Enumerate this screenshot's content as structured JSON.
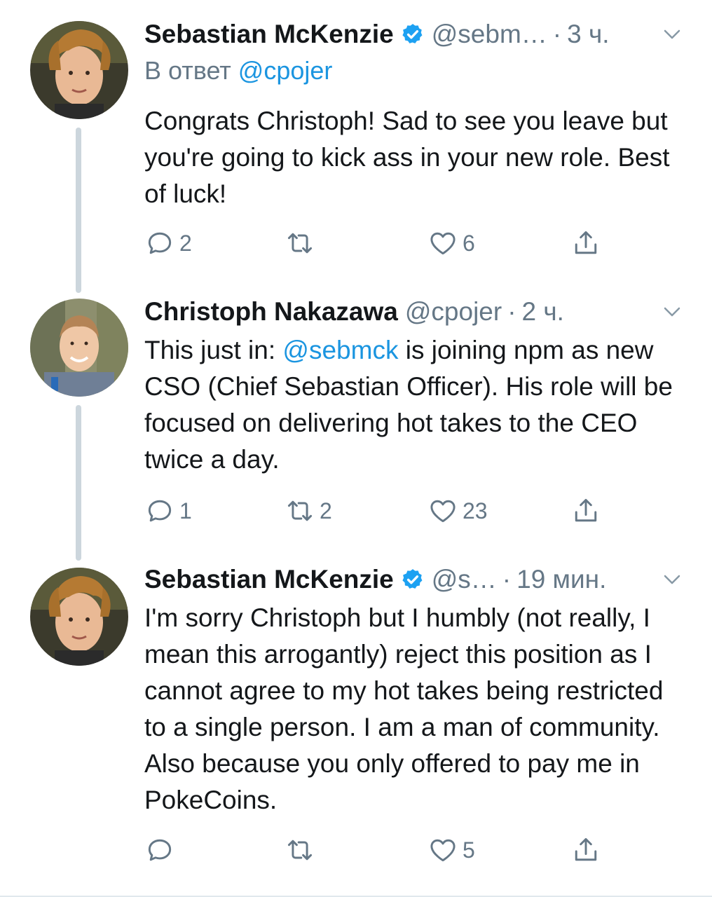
{
  "tweets": [
    {
      "name": "Sebastian McKenzie",
      "handle": "@sebm…",
      "time": "3 ч.",
      "reply_prefix": "В ответ",
      "reply_to": "@cpojer",
      "text": "Congrats Christoph! Sad to see you leave but you're going to kick ass in your new role. Best of luck!",
      "replies": "2",
      "retweets": "",
      "likes": "6"
    },
    {
      "name": "Christoph Nakazawa",
      "handle": "@cpojer",
      "time": "2 ч.",
      "text_before_mention": "This just in: ",
      "mention": "@sebmck",
      "text_after_mention": " is joining npm as new CSO (Chief Sebastian Officer). His role will be focused on delivering hot takes to the CEO twice a day.",
      "replies": "1",
      "retweets": "2",
      "likes": "23"
    },
    {
      "name": "Sebastian McKenzie",
      "handle": "@s…",
      "time": "19 мин.",
      "text": "I'm sorry Christoph but I humbly (not really, I mean this arrogantly) reject this position as I cannot agree to my hot takes being restricted to a single person. I am a man of community. Also because you only offered to pay me in PokeCoins.",
      "replies": "",
      "retweets": "",
      "likes": "5"
    }
  ],
  "separator": "·",
  "icons": {
    "verified": "verified-badge-icon",
    "menu": "chevron-down-icon",
    "reply": "reply-icon",
    "retweet": "retweet-icon",
    "like": "heart-icon",
    "share": "share-icon"
  },
  "colors": {
    "link": "#1b95e0",
    "secondary_text": "#657786",
    "primary_text": "#14171a",
    "thread_line": "#ccd6dd",
    "verified": "#1da1f2"
  }
}
